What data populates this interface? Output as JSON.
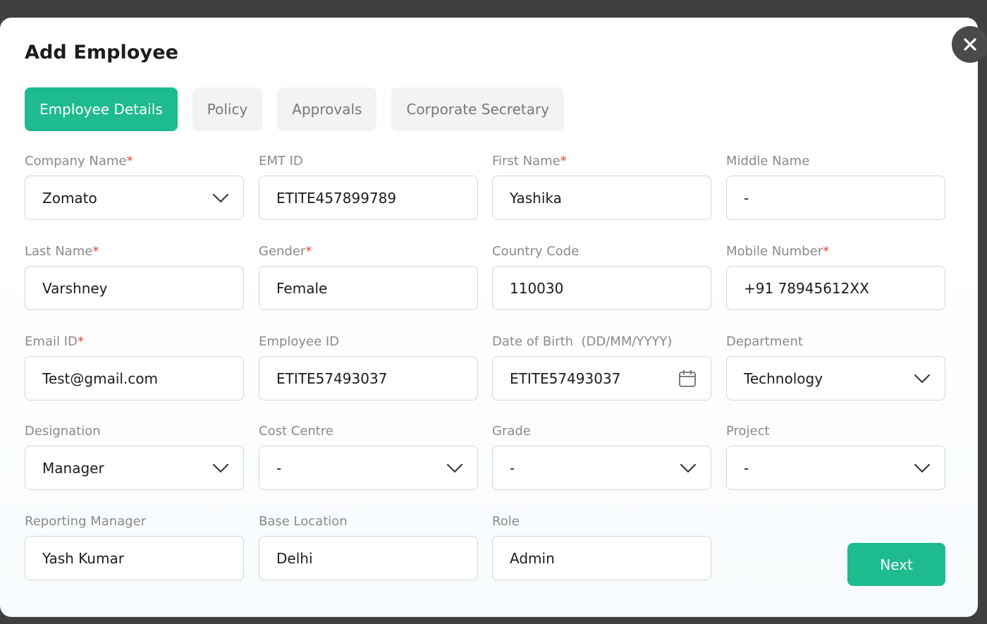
{
  "modal": {
    "title": "Add Employee",
    "tabs": [
      {
        "label": "Employee Details",
        "active": true
      },
      {
        "label": "Policy",
        "active": false
      },
      {
        "label": "Approvals",
        "active": false
      },
      {
        "label": "Corporate Secretary",
        "active": false
      }
    ],
    "next_label": "Next",
    "date_hint": "(DD/MM/YYYY)"
  },
  "fields": {
    "company_name": {
      "label": "Company Name",
      "value": "Zomato"
    },
    "emt_id": {
      "label": "EMT ID",
      "value": "ETITE457899789"
    },
    "first_name": {
      "label": "First Name",
      "value": "Yashika"
    },
    "middle_name": {
      "label": "Middle Name",
      "value": "-"
    },
    "last_name": {
      "label": "Last Name",
      "value": "Varshney"
    },
    "gender": {
      "label": "Gender",
      "value": "Female"
    },
    "country_code": {
      "label": "Country Code",
      "value": "110030"
    },
    "mobile_number": {
      "label": "Mobile Number",
      "value": "+91 78945612XX"
    },
    "email_id": {
      "label": "Email ID",
      "value": "Test@gmail.com"
    },
    "employee_id": {
      "label": "Employee ID",
      "value": "ETITE57493037"
    },
    "date_of_birth": {
      "label": "Date of Birth",
      "value": "ETITE57493037"
    },
    "department": {
      "label": "Department",
      "value": "Technology"
    },
    "designation": {
      "label": "Designation",
      "value": "Manager"
    },
    "cost_centre": {
      "label": "Cost Centre",
      "value": "-"
    },
    "grade": {
      "label": "Grade",
      "value": "-"
    },
    "project": {
      "label": "Project",
      "value": "-"
    },
    "reporting_manager": {
      "label": "Reporting Manager",
      "value": "Yash Kumar"
    },
    "base_location": {
      "label": "Base Location",
      "value": "Delhi"
    },
    "role": {
      "label": "Role",
      "value": "Admin"
    }
  },
  "colors": {
    "accent": "#1dbb8e",
    "required": "#e04a2b",
    "overlay": "#3f3f3f"
  },
  "icons": {
    "close": "close-icon",
    "dropdown": "chevron-down-icon",
    "date": "calendar-icon"
  }
}
